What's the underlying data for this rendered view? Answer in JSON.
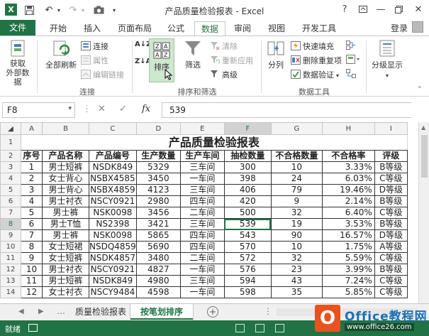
{
  "window": {
    "title": "产品质量检验报表 - Excel",
    "help": "?",
    "app_icon": "X"
  },
  "quick_access": {
    "icons": [
      "excel-icon",
      "save-icon",
      "undo-icon",
      "redo-icon",
      "camera-icon"
    ]
  },
  "menu": {
    "tabs": [
      "文件",
      "开始",
      "插入",
      "页面布局",
      "公式",
      "数据",
      "审阅",
      "视图",
      "开发工具"
    ],
    "active_tab": "数据",
    "login": "登录"
  },
  "ribbon": {
    "get_external": "获取\n外部数据",
    "refresh_all": "全部刷新",
    "connections": "连接",
    "properties": "属性",
    "edit_links": "编辑链接",
    "group_connections": "连接",
    "sort_az": "A↓Z",
    "sort_za": "Z↓A",
    "sort": "排序",
    "filter": "筛选",
    "clear": "清除",
    "reapply": "重新应用",
    "advanced": "高级",
    "group_sort_filter": "排序和筛选",
    "text_to_columns": "分列",
    "flash_fill": "快速填充",
    "remove_duplicates": "删除重复项",
    "data_validation": "数据验证",
    "group_data_tools": "数据工具",
    "outline": "分级显示"
  },
  "formula_bar": {
    "name_box": "F8",
    "fx": "fx",
    "value": "539"
  },
  "sheet": {
    "columns": [
      "A",
      "B",
      "C",
      "D",
      "E",
      "F",
      "G",
      "H",
      "I"
    ],
    "title": "产品质量检验报表",
    "headers": [
      "序号",
      "产品名称",
      "产品编号",
      "生产数量",
      "生产车间",
      "抽检数量",
      "不合格数量",
      "不合格率",
      "评级"
    ],
    "rows": [
      [
        "1",
        "男士短裤",
        "NSDK849",
        "5329",
        "三车间",
        "300",
        "10",
        "3.33%",
        "B等级"
      ],
      [
        "2",
        "女士背心",
        "NSBX4585",
        "3450",
        "一车间",
        "398",
        "24",
        "6.03%",
        "C等级"
      ],
      [
        "3",
        "男士背心",
        "NSBX4859",
        "4123",
        "三车间",
        "406",
        "79",
        "19.46%",
        "D等级"
      ],
      [
        "4",
        "男士衬衣",
        "NSCY0921",
        "2980",
        "四车间",
        "420",
        "9",
        "2.14%",
        "B等级"
      ],
      [
        "5",
        "男士裤",
        "NSK0098",
        "3456",
        "二车间",
        "500",
        "32",
        "6.40%",
        "C等级"
      ],
      [
        "6",
        "男士T恤",
        "NS2398",
        "3421",
        "三车间",
        "539",
        "19",
        "3.53%",
        "B等级"
      ],
      [
        "7",
        "男士裤",
        "NSK0098",
        "5865",
        "四车间",
        "543",
        "90",
        "16.57%",
        "D等级"
      ],
      [
        "8",
        "女士短裙",
        "NSDQ4859",
        "5690",
        "四车间",
        "570",
        "10",
        "1.75%",
        "A等级"
      ],
      [
        "9",
        "女士短裤",
        "NSDK4857",
        "3480",
        "二车间",
        "572",
        "32",
        "5.59%",
        "C等级"
      ],
      [
        "10",
        "男士衬衣",
        "NSCY0921",
        "4827",
        "一车间",
        "576",
        "23",
        "3.99%",
        "B等级"
      ],
      [
        "11",
        "男士短裤",
        "NSDK849",
        "4980",
        "三车间",
        "594",
        "43",
        "7.24%",
        "C等级"
      ],
      [
        "12",
        "女士衬衣",
        "NSCY9484",
        "4598",
        "一车间",
        "598",
        "35",
        "5.85%",
        "C等级"
      ]
    ],
    "selected_cell": "F8"
  },
  "sheet_tabs": {
    "tabs": [
      "质量检验报表",
      "按笔划排序"
    ],
    "active": "按笔划排序",
    "add": "+"
  },
  "status": {
    "text": "就绪"
  },
  "watermark": {
    "logo": "O",
    "title": "Office教程网",
    "url": "www.office26.com"
  },
  "colors": {
    "accent": "#217346",
    "watermark_logo": "#e8521f",
    "watermark_title": "#1a6fb5"
  }
}
